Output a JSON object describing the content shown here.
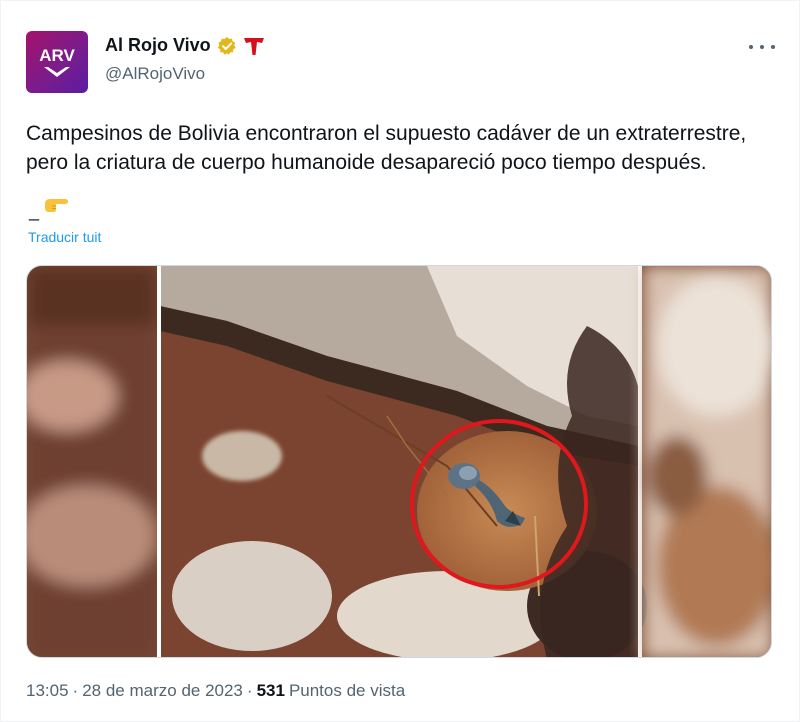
{
  "account": {
    "display_name": "Al Rojo Vivo",
    "handle": "@AlRojoVivo",
    "avatar_text": "ARV",
    "verified_color": "#e2b719",
    "brand_icon": "telemundo-t-icon"
  },
  "tweet": {
    "text": "Campesinos de Bolivia encontraron el supuesto cadáver de un extraterrestre, pero la criatura de cuerpo humanoide desapareció poco tiempo después.",
    "emoji_prefix": "_",
    "emoji": "👉",
    "translate_label": "Traducir tuit"
  },
  "meta": {
    "time": "13:05",
    "separator": "·",
    "date": "28 de marzo de 2023",
    "views_count": "531",
    "views_label": "Puntos de vista"
  },
  "colors": {
    "link": "#1d9bf0",
    "secondary_text": "#536471",
    "primary_text": "#0f1419",
    "highlight_circle": "#e0171c"
  }
}
